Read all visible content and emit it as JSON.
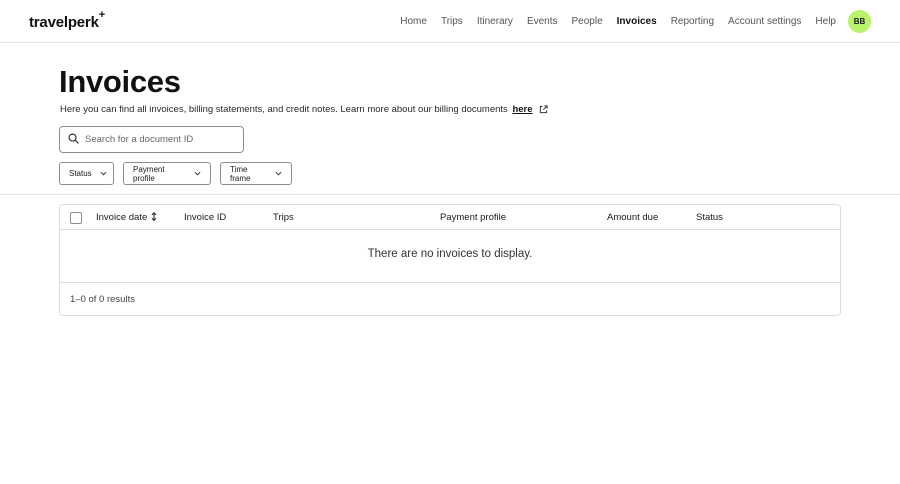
{
  "header": {
    "logo": "travelperk",
    "logo_plus": "+",
    "nav": [
      {
        "label": "Home"
      },
      {
        "label": "Trips"
      },
      {
        "label": "Itinerary"
      },
      {
        "label": "Events"
      },
      {
        "label": "People"
      },
      {
        "label": "Invoices",
        "active": true
      },
      {
        "label": "Reporting"
      },
      {
        "label": "Account settings"
      },
      {
        "label": "Help"
      }
    ],
    "avatar_initials": "BB",
    "avatar_color": "#b9f26b"
  },
  "page": {
    "title": "Invoices",
    "subtitle": "Here you can find all invoices, billing statements, and credit notes. Learn more about our billing documents",
    "subtitle_link": "here",
    "subtitle_link_icon": "external-link-icon"
  },
  "search": {
    "icon": "search-icon",
    "placeholder": "Search for a document ID",
    "value": ""
  },
  "filters": {
    "status": "Status",
    "payment_profile": "Payment profile",
    "time_frame": "Time frame"
  },
  "table": {
    "columns": {
      "invoice_date": "Invoice date",
      "invoice_id": "Invoice ID",
      "trips": "Trips",
      "payment_profile": "Payment profile",
      "amount_due": "Amount due",
      "status": "Status"
    },
    "rows": [],
    "empty_message": "There are no invoices to display.",
    "results_text": "1–0 of 0 results"
  }
}
